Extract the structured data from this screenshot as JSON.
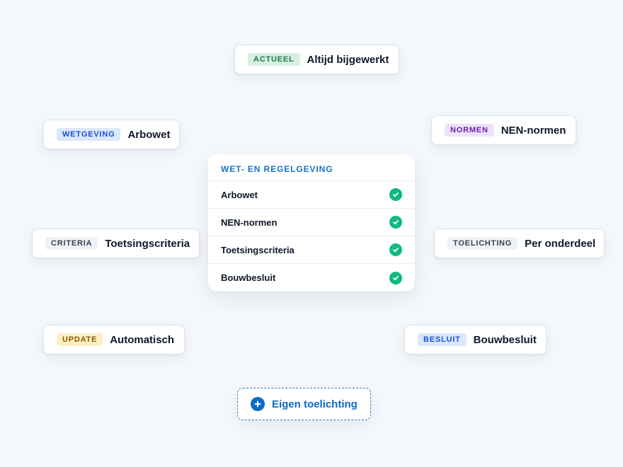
{
  "chips": {
    "actueel": {
      "tag": "ACTUEEL",
      "label": "Altijd bijgewerkt",
      "tag_color": "#1f7a46",
      "tag_bg": "#d6efe2"
    },
    "wetgeving": {
      "tag": "WETGEVING",
      "label": "Arbowet",
      "tag_color": "#1d4ed8",
      "tag_bg": "#dbe7fb"
    },
    "normen": {
      "tag": "NORMEN",
      "label": "NEN-normen",
      "tag_color": "#6b21a8",
      "tag_bg": "#ece2fb"
    },
    "criteria": {
      "tag": "CRITERIA",
      "label": "Toetsingscriteria",
      "tag_color": "#374151",
      "tag_bg": "#eef1f5"
    },
    "toelichting": {
      "tag": "TOELICHTING",
      "label": "Per onderdeel",
      "tag_color": "#374151",
      "tag_bg": "#eef1f5"
    },
    "update": {
      "tag": "UPDATE",
      "label": "Automatisch",
      "tag_color": "#8a5a00",
      "tag_bg": "#fcefc4"
    },
    "besluit": {
      "tag": "BESLUIT",
      "label": "Bouwbesluit",
      "tag_color": "#1d4ed8",
      "tag_bg": "#dbe7fb"
    }
  },
  "panel": {
    "title": "WET- EN REGELGEVING",
    "items": [
      {
        "label": "Arbowet",
        "status_icon": "check-circle-icon"
      },
      {
        "label": "NEN-normen",
        "status_icon": "check-circle-icon"
      },
      {
        "label": "Toetsingscriteria",
        "status_icon": "check-circle-icon"
      },
      {
        "label": "Bouwbesluit",
        "status_icon": "check-circle-icon"
      }
    ],
    "check_color": "#10b981",
    "title_color": "#1673c4"
  },
  "add_button": {
    "label": "Eigen toelichting",
    "icon": "plus-circle-icon",
    "color": "#0b6bc4"
  },
  "background_color": "#f4f8fc"
}
